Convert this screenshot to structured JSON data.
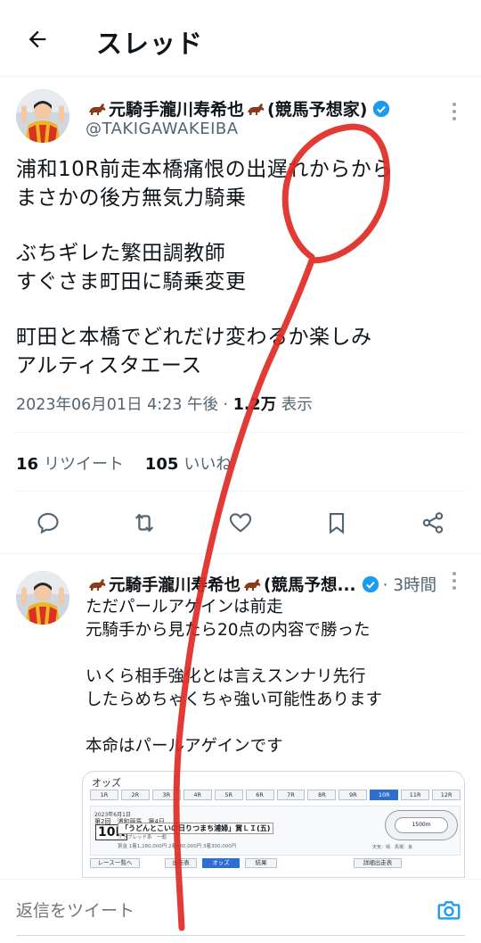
{
  "header": {
    "title": "スレッド"
  },
  "main_tweet": {
    "author": {
      "name": "元騎手瀧川寿希也",
      "name_suffix": "(競馬予想家)",
      "handle": "@TAKIGAWAKEIBA"
    },
    "text_lines": [
      "浦和10R前走本橋痛恨の出遅れからから",
      "まさかの後方無気力騎乗",
      "",
      "ぶちギレた繁田調教師",
      "すぐさま町田に騎乗変更",
      "",
      "町田と本橋でどれだけ変わるか楽しみ",
      "アルティスタエース"
    ],
    "timestamp": "2023年06月01日 4:23 午後 · ",
    "views_count": "1.2万",
    "views_label": "表示",
    "retweets_count": "16",
    "retweets_label": "リツイート",
    "likes_count": "105",
    "likes_label": "いいね"
  },
  "reply_tweet": {
    "author_name": "元騎手瀧川寿希也",
    "author_suffix": "(競馬予想...",
    "time": "· 3時間",
    "text_lines": [
      "ただパールアゲインは前走",
      "元騎手から見たら20点の内容で勝った",
      "",
      "いくら相手強化とは言えスンナリ先行",
      "したらめちゃくちゃ強い可能性あります",
      "",
      "本命はパールアゲインです"
    ],
    "media": {
      "title": "オッズ",
      "tabs": [
        "1R",
        "2R",
        "3R",
        "4R",
        "5R",
        "6R",
        "7R",
        "8R",
        "9R",
        "10R",
        "11R",
        "12R"
      ],
      "active_tab": "10R",
      "race_date": "2023年6月1日",
      "race_meet": "第2回　浦和競馬　第4日",
      "race_number": "10R",
      "race_name": "「うどんとこいの日りつまち浦婦」賞ＬＩ(五)",
      "race_distance": "1,500m",
      "race_class": "サラブレッド系　一般",
      "race_prize": "賞金 1着1,280,000円 2着480,000円 3着300,000円",
      "track_label": "1500m",
      "race_right": "天気：晴　馬場：良",
      "btn_prev": "レース一覧へ",
      "btn_table": "出走表",
      "btn_odds": "オッズ",
      "btn_result": "結果",
      "btn_detail": "詳細出走表"
    }
  },
  "compose": {
    "placeholder": "返信をツイート"
  },
  "colors": {
    "accent": "#1d9bf0",
    "secondary_text": "#536471",
    "scribble": "#e02a24"
  }
}
